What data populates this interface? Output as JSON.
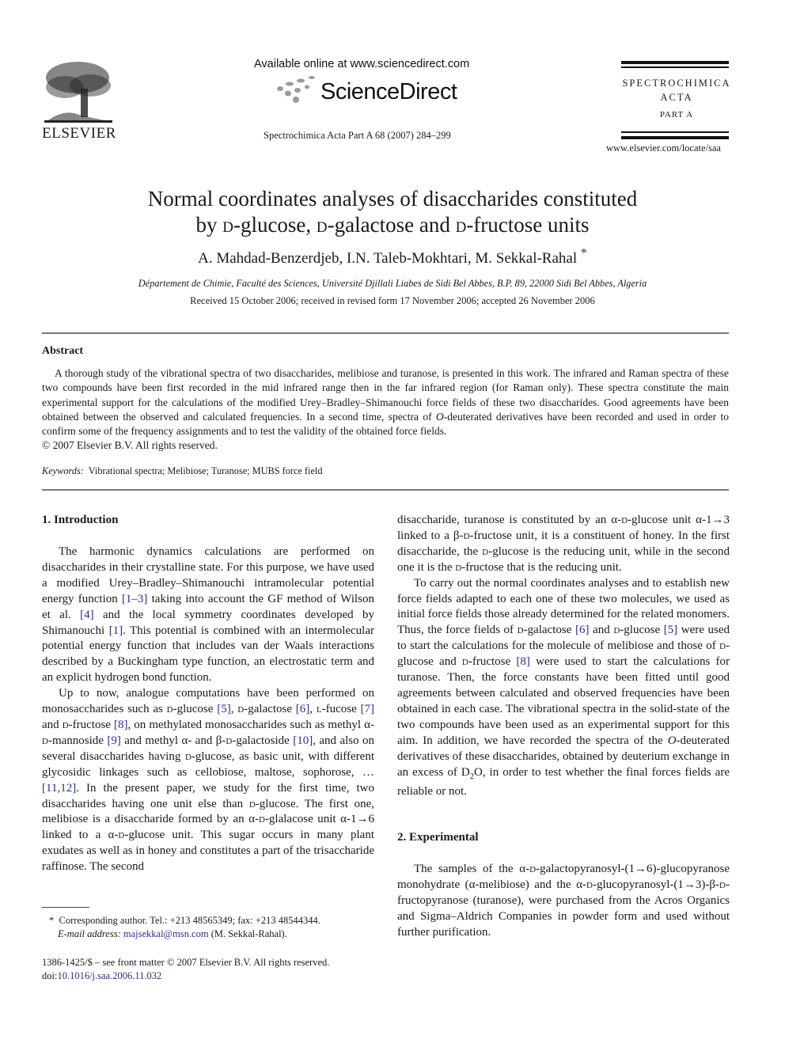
{
  "header": {
    "publisher_logo_icon": "elsevier-tree-logo",
    "publisher_name": "ELSEVIER",
    "available_online": "Available online at www.sciencedirect.com",
    "sciencedirect_logo_icon": "sciencedirect-dots-logo",
    "sciencedirect_name": "ScienceDirect",
    "journal_reference": "Spectrochimica Acta Part A  68 (2007) 284–299",
    "journal_name_line1": "SPECTROCHIMICA",
    "journal_name_line2": "ACTA",
    "journal_part": "PART A",
    "journal_url": "www.elsevier.com/locate/saa"
  },
  "article": {
    "title_line1": "Normal coordinates analyses of disaccharides constituted",
    "title_line2_pre": "by ",
    "title_d1": "d",
    "title_glucose": "-glucose, ",
    "title_d2": "d",
    "title_galactose": "-galactose and ",
    "title_d3": "d",
    "title_fructose": "-fructose units",
    "authors": "A. Mahdad-Benzerdjeb, I.N. Taleb-Mokhtari, M. Sekkal-Rahal",
    "corresponding_mark": "*",
    "affiliation": "Département de Chimie, Faculté des Sciences, Université Djillali Liabes de Sidi Bel Abbes, B.P. 89, 22000 Sidi Bel Abbes, Algeria",
    "dates": "Received 15 October 2006; received in revised form 17 November 2006; accepted 26 November 2006"
  },
  "abstract": {
    "heading": "Abstract",
    "text_part1": "A thorough study of the vibrational spectra of two disaccharides, melibiose and turanose, is presented in this work. The infrared and Raman spectra of these two compounds have been first recorded in the mid infrared range then in the far infrared region (for Raman only). These spectra constitute the main experimental support for the calculations of the modified Urey–Bradley–Shimanouchi force fields of these two disaccharides. Good agreements have been obtained between the observed and calculated frequencies. In a second time, spectra of ",
    "text_italic_O": "O",
    "text_part2": "-deuterated derivatives have been recorded and used in order to confirm some of the frequency assignments and to test the validity of the obtained force fields.",
    "copyright": "© 2007 Elsevier B.V. All rights reserved.",
    "keywords_label": "Keywords:",
    "keywords": "Vibrational spectra; Melibiose; Turanose; MUBS force field"
  },
  "sections": {
    "intro_heading": "1.  Introduction",
    "intro_p1": [
      "The harmonic dynamics calculations are performed on disaccharides in their crystalline state. For this purpose, we have used a modified Urey–Bradley–Shimanouchi intramolecular potential energy function ",
      "[1–3]",
      " taking into account the GF method of Wilson et al. ",
      "[4]",
      " and the local symmetry coordinates developed by Shimanouchi ",
      "[1]",
      ". This potential is combined with an intermolecular potential energy function that includes van der Waals interactions described by a Buckingham type function, an electrostatic term and an explicit hydrogen bond function."
    ],
    "intro_p2": [
      "Up to now, analogue computations have been performed on monosaccharides such as ",
      "d",
      "-glucose ",
      "[5]",
      ", ",
      "d",
      "-galactose ",
      "[6]",
      ", ",
      "l",
      "-fucose ",
      "[7]",
      " and ",
      "d",
      "-fructose ",
      "[8]",
      ", on methylated monosaccharides such as methyl α-",
      "d",
      "-mannoside ",
      "[9]",
      " and methyl α- and β-",
      "d",
      "-galactoside ",
      "[10]",
      ", and also on several disaccharides having ",
      "d",
      "-glucose, as basic unit, with different glycosidic linkages such as cellobiose, maltose, sophorose, … ",
      "[11,12]",
      ". In the present paper, we study for the first time, two disaccharides having one unit else than ",
      "d",
      "-glucose. The first one, melibiose is a disaccharide formed by an α-",
      "d",
      "-glalacose unit α-1→6 linked to a α-",
      "d",
      "-glucose unit. This sugar occurs in many plant exudates as well as in honey and constitutes a part of the trisaccharide raffinose. The second disaccharide, turanose is constituted by an α-",
      "d",
      "-glucose unit α-1→3 linked to a β-",
      "d",
      "-fructose unit, it is a constituent of honey. In the first disaccharide, the ",
      "d",
      "-glucose is the reducing unit, while in the second one it is the ",
      "d",
      "-fructose that is the reducing unit."
    ],
    "intro_p3": [
      "To carry out the normal coordinates analyses and to establish new force fields adapted to each one of these two molecules, we used as initial force fields those already determined for the related monomers. Thus, the force fields of ",
      "d",
      "-galactose ",
      "[6]",
      " and ",
      "d",
      "-glucose ",
      "[5]",
      " were used to start the calculations for the molecule of melibiose and those of ",
      "d",
      "-glucose and ",
      "d",
      "-fructose ",
      "[8]",
      " were used to start the calculations for turanose. Then, the force constants have been fitted until good agreements between calculated and observed frequencies have been obtained in each case. The vibrational spectra in the solid-state of the two compounds have been used as an experimental support for this aim. In addition, we have recorded the spectra of the ",
      "O",
      "-deuterated derivatives of these disaccharides, obtained by deuterium exchange in an excess of D",
      "2",
      "O, in order to test whether the final forces fields are reliable or not."
    ],
    "exp_heading": "2.  Experimental",
    "exp_p1": [
      "The samples of the α-",
      "d",
      "-galactopyranosyl-(1→6)-glucopyranose monohydrate (α-melibiose) and the α-",
      "d",
      "-glucopyranosyl-(1→3)-β-",
      "d",
      "-fructopyranose (turanose), were purchased from the Acros Organics and Sigma–Aldrich Companies in powder form and used without further purification."
    ]
  },
  "footnotes": {
    "star": "*",
    "corresponding": "Corresponding author. Tel.: +213 48565349; fax: +213 48544344.",
    "email_label": "E-mail address:",
    "email": "majsekkal@msn.com",
    "email_suffix": " (M. Sekkal-Rahal).",
    "issn_line": "1386-1425/$ – see front matter © 2007 Elsevier B.V. All rights reserved.",
    "doi_label": "doi:",
    "doi": "10.1016/j.saa.2006.11.032"
  },
  "colors": {
    "link": "#2a2f8a",
    "rule": "#777777",
    "text": "#1a1a1a"
  }
}
